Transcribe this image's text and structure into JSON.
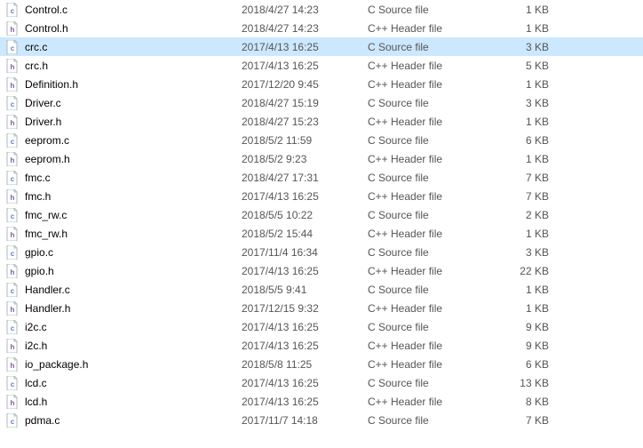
{
  "files": [
    {
      "name": "Control.c",
      "date": "2018/4/27 14:23",
      "type": "C Source file",
      "size": "1 KB",
      "ext": "c",
      "selected": false
    },
    {
      "name": "Control.h",
      "date": "2018/4/27 14:23",
      "type": "C++ Header file",
      "size": "1 KB",
      "ext": "h",
      "selected": false
    },
    {
      "name": "crc.c",
      "date": "2017/4/13 16:25",
      "type": "C Source file",
      "size": "3 KB",
      "ext": "c",
      "selected": true
    },
    {
      "name": "crc.h",
      "date": "2017/4/13 16:25",
      "type": "C++ Header file",
      "size": "5 KB",
      "ext": "h",
      "selected": false
    },
    {
      "name": "Definition.h",
      "date": "2017/12/20 9:45",
      "type": "C++ Header file",
      "size": "1 KB",
      "ext": "h",
      "selected": false
    },
    {
      "name": "Driver.c",
      "date": "2018/4/27 15:19",
      "type": "C Source file",
      "size": "3 KB",
      "ext": "c",
      "selected": false
    },
    {
      "name": "Driver.h",
      "date": "2018/4/27 15:23",
      "type": "C++ Header file",
      "size": "1 KB",
      "ext": "h",
      "selected": false
    },
    {
      "name": "eeprom.c",
      "date": "2018/5/2 11:59",
      "type": "C Source file",
      "size": "6 KB",
      "ext": "c",
      "selected": false
    },
    {
      "name": "eeprom.h",
      "date": "2018/5/2 9:23",
      "type": "C++ Header file",
      "size": "1 KB",
      "ext": "h",
      "selected": false
    },
    {
      "name": "fmc.c",
      "date": "2018/4/27 17:31",
      "type": "C Source file",
      "size": "7 KB",
      "ext": "c",
      "selected": false
    },
    {
      "name": "fmc.h",
      "date": "2017/4/13 16:25",
      "type": "C++ Header file",
      "size": "7 KB",
      "ext": "h",
      "selected": false
    },
    {
      "name": "fmc_rw.c",
      "date": "2018/5/5 10:22",
      "type": "C Source file",
      "size": "2 KB",
      "ext": "c",
      "selected": false
    },
    {
      "name": "fmc_rw.h",
      "date": "2018/5/2 15:44",
      "type": "C++ Header file",
      "size": "1 KB",
      "ext": "h",
      "selected": false
    },
    {
      "name": "gpio.c",
      "date": "2017/11/4 16:34",
      "type": "C Source file",
      "size": "3 KB",
      "ext": "c",
      "selected": false
    },
    {
      "name": "gpio.h",
      "date": "2017/4/13 16:25",
      "type": "C++ Header file",
      "size": "22 KB",
      "ext": "h",
      "selected": false
    },
    {
      "name": "Handler.c",
      "date": "2018/5/5 9:41",
      "type": "C Source file",
      "size": "1 KB",
      "ext": "c",
      "selected": false
    },
    {
      "name": "Handler.h",
      "date": "2017/12/15 9:32",
      "type": "C++ Header file",
      "size": "1 KB",
      "ext": "h",
      "selected": false
    },
    {
      "name": "i2c.c",
      "date": "2017/4/13 16:25",
      "type": "C Source file",
      "size": "9 KB",
      "ext": "c",
      "selected": false
    },
    {
      "name": "i2c.h",
      "date": "2017/4/13 16:25",
      "type": "C++ Header file",
      "size": "9 KB",
      "ext": "h",
      "selected": false
    },
    {
      "name": "io_package.h",
      "date": "2018/5/8 11:25",
      "type": "C++ Header file",
      "size": "6 KB",
      "ext": "h",
      "selected": false
    },
    {
      "name": "lcd.c",
      "date": "2017/4/13 16:25",
      "type": "C Source file",
      "size": "13 KB",
      "ext": "c",
      "selected": false
    },
    {
      "name": "lcd.h",
      "date": "2017/4/13 16:25",
      "type": "C++ Header file",
      "size": "8 KB",
      "ext": "h",
      "selected": false
    },
    {
      "name": "pdma.c",
      "date": "2017/11/7 14:18",
      "type": "C Source file",
      "size": "7 KB",
      "ext": "c",
      "selected": false
    }
  ],
  "icons": {
    "c_letter": "c",
    "h_letter": "h"
  }
}
